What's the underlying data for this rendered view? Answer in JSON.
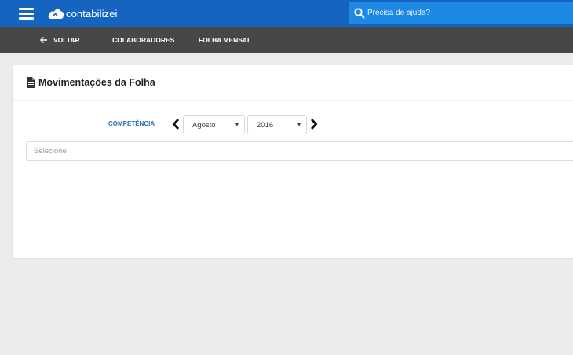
{
  "topbar": {
    "brand": "contabilizei",
    "search_placeholder": "Precisa de ajuda?",
    "accent_color": "#1565c0"
  },
  "nav": {
    "back_label": "VOLTAR",
    "items": [
      {
        "label": "COLABORADORES"
      },
      {
        "label": "FOLHA MENSAL"
      }
    ]
  },
  "card": {
    "title": "Movimentações da Folha",
    "competencia_label": "COMPETÊNCIA",
    "month_selected": "Agosto",
    "year_selected": "2016",
    "selecione_placeholder": "Selecione"
  },
  "icons": {
    "menu": "hamburger-menu-icon",
    "logo": "cloud-logo-icon",
    "search": "search-icon",
    "back": "arrow-left-icon",
    "document": "document-icon",
    "prev": "chevron-left-icon",
    "next": "chevron-right-icon"
  }
}
